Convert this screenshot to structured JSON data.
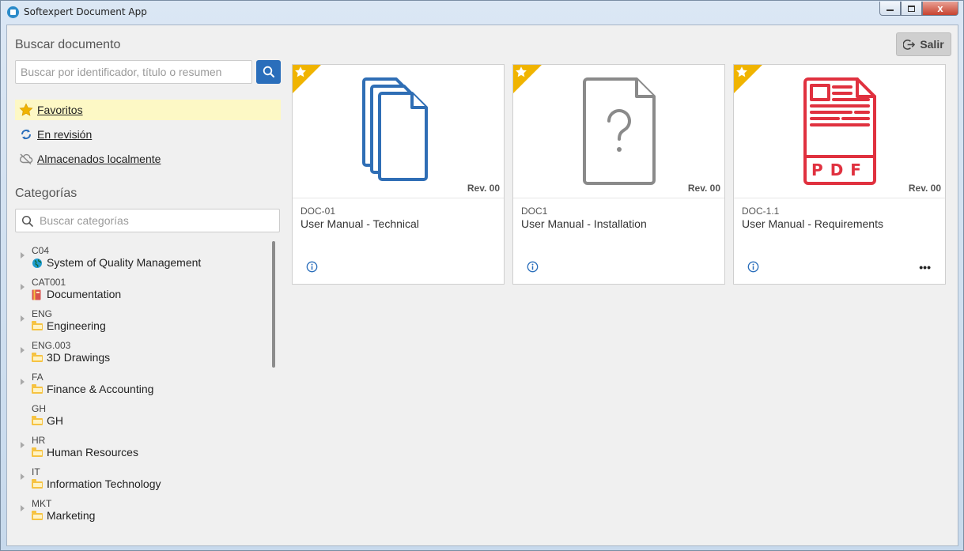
{
  "window": {
    "title": "Softexpert Document App",
    "buttons": {
      "minimize": "minimize",
      "maximize": "maximize",
      "close": "x"
    }
  },
  "search": {
    "title": "Buscar documento",
    "placeholder": "Buscar por identificador, título o resumen",
    "button_icon": "search-icon"
  },
  "nav": {
    "favorites": "Favoritos",
    "in_review": "En revisión",
    "local": "Almacenados localmente"
  },
  "categories": {
    "title": "Categorías",
    "placeholder": "Buscar categorías",
    "items": [
      {
        "code": "C04",
        "name": "System of Quality Management",
        "icon": "globe-icon",
        "expandable": true
      },
      {
        "code": "CAT001",
        "name": "Documentation",
        "icon": "book-icon",
        "expandable": true
      },
      {
        "code": "ENG",
        "name": "Engineering",
        "icon": "folder-icon",
        "expandable": true
      },
      {
        "code": "ENG.003",
        "name": "3D Drawings",
        "icon": "folder-icon",
        "expandable": true
      },
      {
        "code": "FA",
        "name": "Finance & Accounting",
        "icon": "folder-icon",
        "expandable": true
      },
      {
        "code": "GH",
        "name": "GH",
        "icon": "folder-icon",
        "expandable": false
      },
      {
        "code": "HR",
        "name": "Human Resources",
        "icon": "folder-icon",
        "expandable": true
      },
      {
        "code": "IT",
        "name": "Information Technology",
        "icon": "folder-icon",
        "expandable": true
      },
      {
        "code": "MKT",
        "name": "Marketing",
        "icon": "folder-icon",
        "expandable": true
      }
    ]
  },
  "header": {
    "exit_label": "Salir"
  },
  "documents": [
    {
      "code": "DOC-01",
      "title": "User Manual - Technical",
      "revision": "Rev. 00",
      "icon": "multi-file-icon",
      "favorite": true,
      "has_more": false
    },
    {
      "code": "DOC1",
      "title": "User Manual - Installation",
      "revision": "Rev. 00",
      "icon": "unknown-file-icon",
      "favorite": true,
      "has_more": false
    },
    {
      "code": "DOC-1.1",
      "title": "User Manual - Requirements",
      "revision": "Rev. 00",
      "icon": "pdf-file-icon",
      "favorite": true,
      "has_more": true,
      "more_label": "•••"
    }
  ],
  "colors": {
    "accent": "#2a6ebb",
    "favorite": "#f0b400",
    "favorites_bg": "#fdf8c5",
    "multi_file": "#2f6eb5",
    "unknown_file": "#8a8a8a",
    "pdf_file": "#e0313f"
  }
}
